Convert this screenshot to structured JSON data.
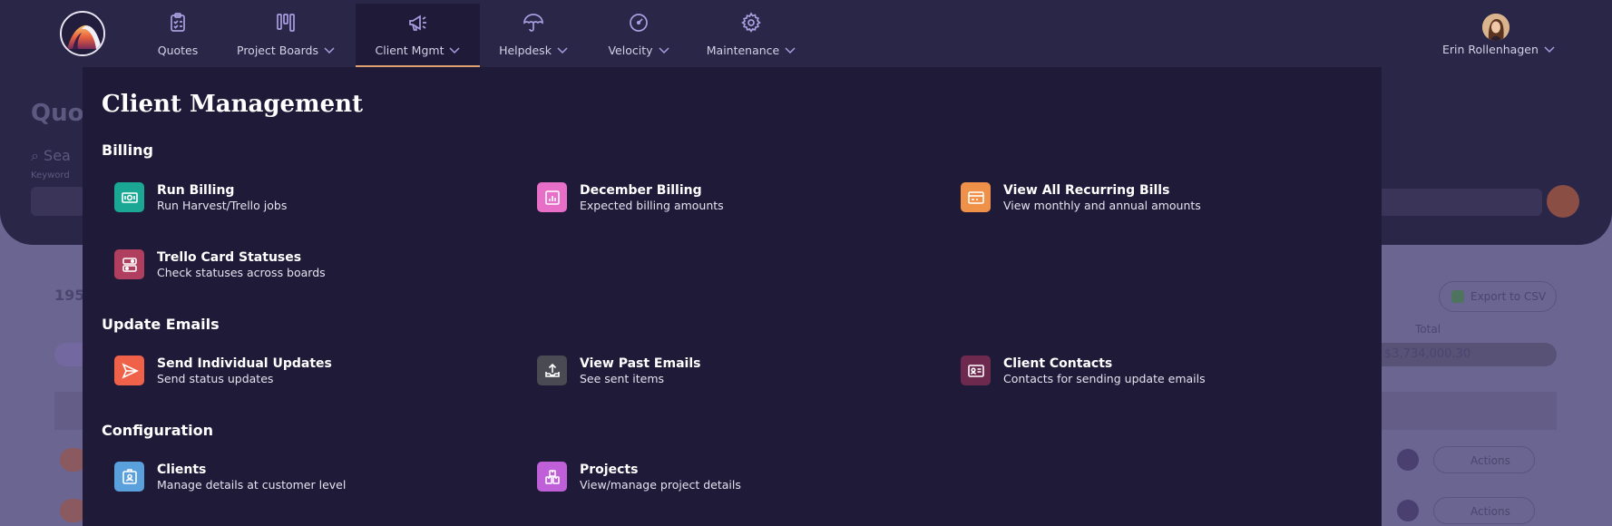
{
  "background": {
    "page_title": "Quo",
    "search_hint": "Sea",
    "keyword_label": "Keyword",
    "record_count": "195",
    "export_label": "Export to CSV",
    "total_label": "Total",
    "total_value": "$3,734,000.30",
    "actions_label": "Actions"
  },
  "nav": {
    "items": [
      {
        "label": "Quotes",
        "icon": "clipboard-icon"
      },
      {
        "label": "Project Boards",
        "icon": "kanban-icon"
      },
      {
        "label": "Client Mgmt",
        "icon": "megaphone-icon"
      },
      {
        "label": "Helpdesk",
        "icon": "umbrella-icon"
      },
      {
        "label": "Velocity",
        "icon": "gauge-icon"
      },
      {
        "label": "Maintenance",
        "icon": "gear-icon"
      }
    ],
    "user_name": "Erin Rollenhagen"
  },
  "menu": {
    "title": "Client Management",
    "sections": [
      {
        "heading": "Billing",
        "items": [
          {
            "title": "Run Billing",
            "subtitle": "Run Harvest/Trello jobs",
            "icon": "cash-icon",
            "color": "#1aa894"
          },
          {
            "title": "December Billing",
            "subtitle": "Expected billing amounts",
            "icon": "chart-icon",
            "color": "#e86fc8"
          },
          {
            "title": "View All Recurring Bills",
            "subtitle": "View monthly and annual amounts",
            "icon": "card-icon",
            "color": "#f0914a"
          },
          {
            "title": "Trello Card Statuses",
            "subtitle": "Check statuses across boards",
            "icon": "toggle-icon",
            "color": "#b03e5e"
          }
        ]
      },
      {
        "heading": "Update Emails",
        "items": [
          {
            "title": "Send Individual Updates",
            "subtitle": "Send status updates",
            "icon": "paper-plane-icon",
            "color": "#f0614a"
          },
          {
            "title": "View Past Emails",
            "subtitle": "See sent items",
            "icon": "inbox-upload-icon",
            "color": "#4a4a52"
          },
          {
            "title": "Client Contacts",
            "subtitle": "Contacts for sending update emails",
            "icon": "contact-card-icon",
            "color": "#6e2a4e"
          }
        ]
      },
      {
        "heading": "Configuration",
        "items": [
          {
            "title": "Clients",
            "subtitle": "Manage details at customer level",
            "icon": "badge-icon",
            "color": "#5aa0dc"
          },
          {
            "title": "Projects",
            "subtitle": "View/manage project details",
            "icon": "boxes-icon",
            "color": "#c060d8"
          }
        ]
      }
    ]
  }
}
